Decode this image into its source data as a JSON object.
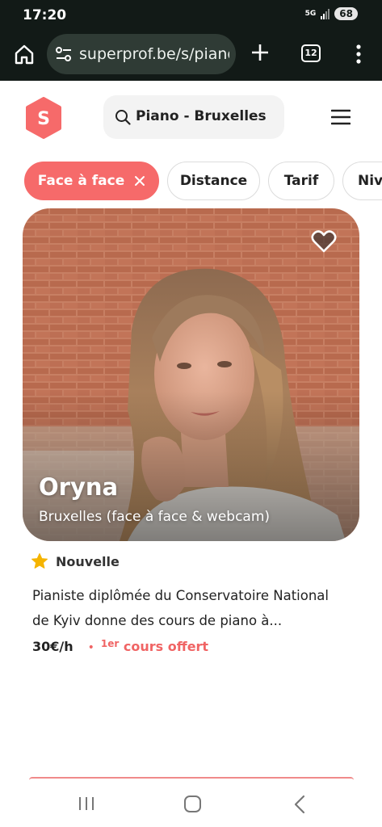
{
  "status": {
    "time": "17:20",
    "network": "5G",
    "battery": "68"
  },
  "browser": {
    "url": "superprof.be/s/piano",
    "tab_count": "12"
  },
  "header": {
    "logo_letter": "S",
    "search_text": "Piano - Bruxelles"
  },
  "filters": [
    {
      "label": "Face à face",
      "active": true
    },
    {
      "label": "Distance",
      "active": false
    },
    {
      "label": "Tarif",
      "active": false
    },
    {
      "label": "Niveau",
      "active": false
    }
  ],
  "card": {
    "name": "Oryna",
    "location": "Bruxelles (face à face & webcam)",
    "badge": "Nouvelle",
    "description": "Pianiste diplômée du Conservatoire National de Kyiv donne des cours de piano à...",
    "price": "30€/h",
    "offer_sup": "1er",
    "offer_rest": " cours offert"
  },
  "colors": {
    "brand": "#f66a6a",
    "star": "#f5b400",
    "chrome_bg": "#121a17"
  },
  "icons": [
    "home-icon",
    "tune-icon",
    "plus-icon",
    "tabs-icon",
    "more-icon",
    "search-icon",
    "menu-icon",
    "close-icon",
    "heart-icon",
    "star-icon",
    "recents-icon",
    "home-nav-icon",
    "back-icon"
  ]
}
